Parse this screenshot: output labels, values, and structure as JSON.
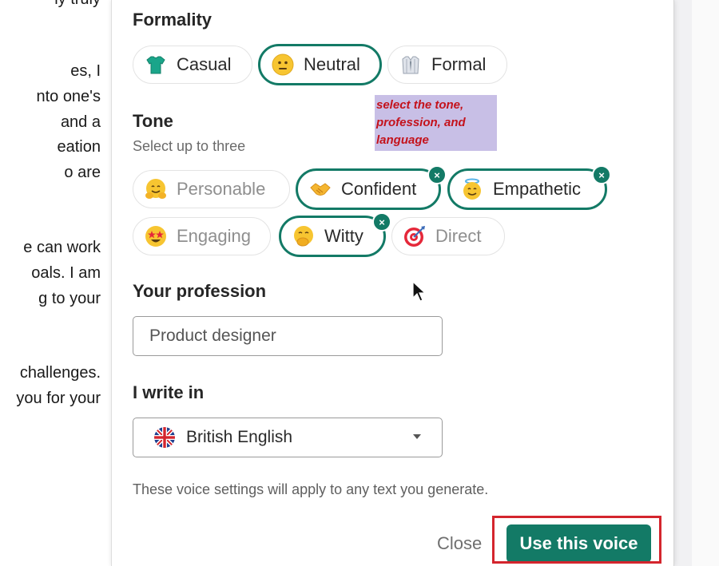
{
  "background_doc": {
    "lines": [
      "ly truly",
      "es, I",
      "nto one's",
      "and a",
      "eation",
      "o are",
      "e can work",
      "oals. I am",
      "g to your",
      "challenges.",
      "you for your"
    ]
  },
  "voice_panel": {
    "formality": {
      "heading": "Formality",
      "options": [
        {
          "label": "Casual",
          "icon": "t-shirt-icon",
          "selected": false
        },
        {
          "label": "Neutral",
          "icon": "neutral-face-icon",
          "selected": true
        },
        {
          "label": "Formal",
          "icon": "formal-shirt-icon",
          "selected": false
        }
      ]
    },
    "tone": {
      "heading": "Tone",
      "subtitle": "Select up to three",
      "options": [
        {
          "label": "Personable",
          "icon": "hugging-face-icon",
          "selected": false
        },
        {
          "label": "Confident",
          "icon": "handshake-icon",
          "selected": true
        },
        {
          "label": "Empathetic",
          "icon": "halo-face-icon",
          "selected": true
        },
        {
          "label": "Engaging",
          "icon": "star-struck-icon",
          "selected": false
        },
        {
          "label": "Witty",
          "icon": "giggle-face-icon",
          "selected": true
        },
        {
          "label": "Direct",
          "icon": "bullseye-icon",
          "selected": false
        }
      ]
    },
    "profession": {
      "heading": "Your profession",
      "value": "Product designer"
    },
    "language": {
      "heading": "I write in",
      "value": "British English",
      "icon": "uk-flag-icon"
    },
    "note": "These voice settings will apply to any text you generate.",
    "close_label": "Close",
    "use_label": "Use this voice"
  },
  "annotation": {
    "text": "select the tone, profession, and language"
  },
  "colors": {
    "accent": "#137a66",
    "highlight_box": "#d4252d",
    "annotation_bg": "#c8bfe6",
    "annotation_text": "#c4121b"
  }
}
